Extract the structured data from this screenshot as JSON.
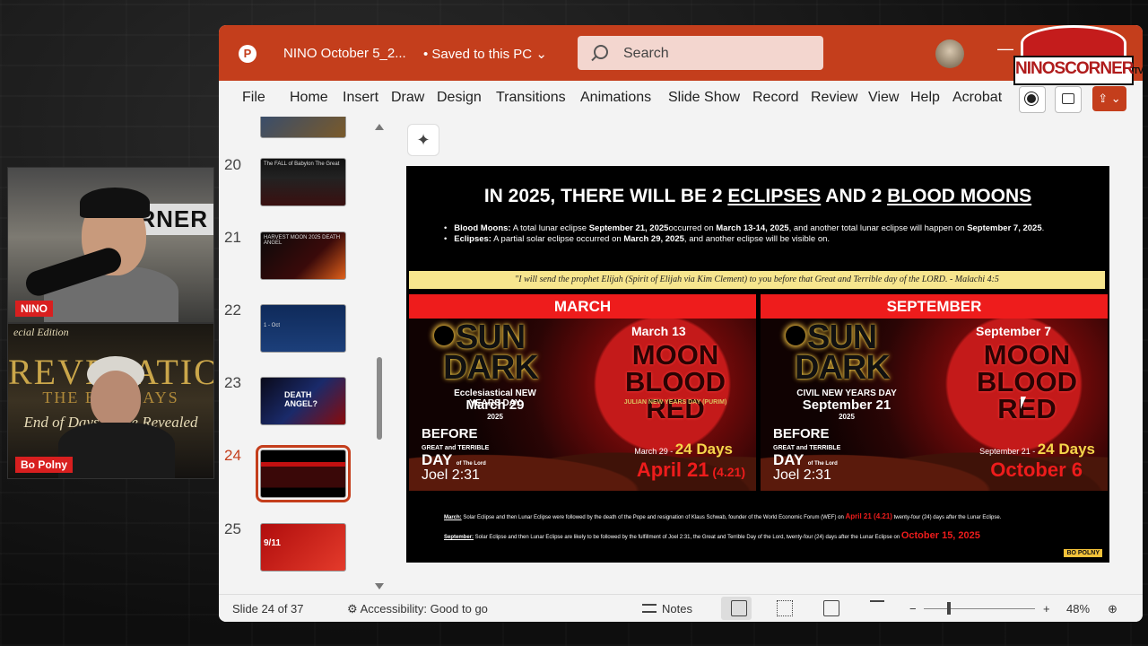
{
  "webcams": {
    "host": {
      "tag": "NINO",
      "sign": "CORNER"
    },
    "guest": {
      "tag": "Bo Polny",
      "backdrop_top": "ecial Edition",
      "backdrop_title": "REVELATION",
      "backdrop_middle": "THE END DAYS",
      "backdrop_bottom": "End of Days: ...ine Revealed"
    }
  },
  "overlay_logo": {
    "text": "NINOSCORNER",
    "tv": "TV"
  },
  "titlebar": {
    "doc_title": "NINO October 5_2...",
    "saved_status": "• Saved to this PC",
    "search_placeholder": "Search",
    "app_logo": "P"
  },
  "ribbon": {
    "tabs": [
      "File",
      "Home",
      "Insert",
      "Draw",
      "Design",
      "Transitions",
      "Animations",
      "Slide Show",
      "Record",
      "Review",
      "View",
      "Help",
      "Acrobat"
    ]
  },
  "thumbnails": [
    {
      "num": "20",
      "label": "The FALL of Babylon The Great"
    },
    {
      "num": "21",
      "label": "HARVEST MOON 2025 DEATH ANGEL"
    },
    {
      "num": "22",
      "label": "1 - Oct"
    },
    {
      "num": "23",
      "label": "DEATH ANGEL?"
    },
    {
      "num": "24",
      "label": ""
    },
    {
      "num": "25",
      "label": "9/11"
    }
  ],
  "slide": {
    "title_parts": {
      "pre": "IN 2025, THERE WILL BE 2 ",
      "u1": "ECLIPSES",
      "mid": " AND 2 ",
      "u2": "BLOOD MOONS"
    },
    "bullet1_label": "Blood Moons:",
    "bullet1_text": " A total lunar eclipse ",
    "bullet1_b1": "September 21, 2025",
    "bullet1_t2": "occurred on ",
    "bullet1_b2": "March 13-14, 2025",
    "bullet1_t3": ", and another total lunar eclipse will happen on ",
    "bullet1_b3": "September 7, 2025",
    "bullet1_t4": ".",
    "bullet2_label": "Eclipses:",
    "bullet2_text": " A partial solar eclipse occurred on ",
    "bullet2_b1": "March 29, 2025",
    "bullet2_t2": ", and another eclipse will be visible on.",
    "quote": "\"I will send the prophet Elijah (Spirit of Elijah via Kim Clement) to you before that Great and Terrible day of the LORD. - Malachi 4:5",
    "march": {
      "head": "MARCH",
      "sun1": "SUN",
      "sun2": "DARK",
      "new_year": "Ecclesiastical NEW YEARS DAY",
      "new_year_date": "March 29",
      "new_year_yr": "2025",
      "moon_date": "March 13",
      "moon1": "MOON",
      "moon2": "BLOOD RED",
      "moon_sub": "JULIAN NEW YEARS DAY (PURIM)",
      "before": "BEFORE",
      "gt": "GREAT and TERRIBLE",
      "day": "DAY",
      "of_lord": "of The Lord",
      "joel": "Joel 2:31",
      "count_from": "March 29 - ",
      "count_days": "24 Days",
      "count_to": "April 21",
      "count_to_small": " (4.21)"
    },
    "september": {
      "head": "SEPTEMBER",
      "sun1": "SUN",
      "sun2": "DARK",
      "new_year": "CIVIL NEW YEARS DAY",
      "new_year_date": "September 21",
      "new_year_yr": "2025",
      "moon_date": "September 7",
      "moon1": "MOON",
      "moon2": "BLOOD RED",
      "before": "BEFORE",
      "gt": "GREAT and TERRIBLE",
      "day": "DAY",
      "of_lord": "of The Lord",
      "joel": "Joel 2:31",
      "count_from": "September 21 - ",
      "count_days": "24 Days",
      "count_to": "October 6"
    },
    "note1_label": "March:",
    "note1_text": " Solar Eclipse and then Lunar Eclipse were followed by the death of the Pope and resignation of Klaus Schwab, founder of the World Economic Forum (WEF) on ",
    "note1_red": "April 21 (4.21)",
    "note1_end": " twenty-four (24) days after the Lunar Eclipse.",
    "note2_label": "September:",
    "note2_text": " Solar Eclipse and then Lunar Eclipse are likely to be followed by the fulfillment of Joel 2:31, the Great and Terrible Day of the Lord, twenty-four (24) days after the Lunar Eclipse on ",
    "note2_red": "October 15, 2025",
    "brand": "BO POLNY"
  },
  "statusbar": {
    "slide_count": "Slide 24 of 37",
    "accessibility": "Accessibility: Good to go",
    "notes": "Notes",
    "zoom_minus": "−",
    "zoom_plus": "+",
    "zoom": "48%"
  },
  "colors": {
    "ppt_red": "#c43e1c",
    "slide_red": "#ee1c1c",
    "quote_bg": "#f7e68e"
  }
}
